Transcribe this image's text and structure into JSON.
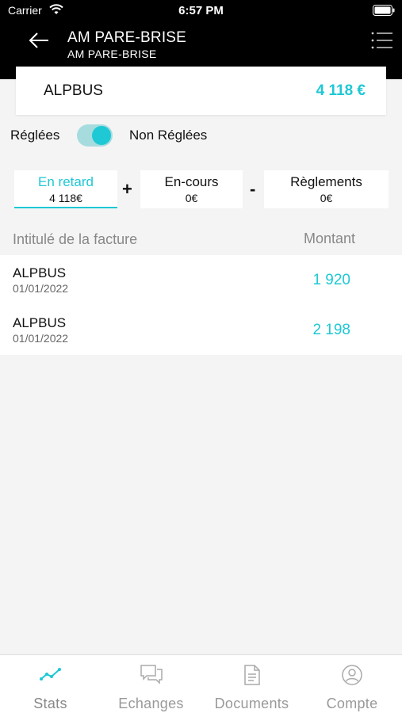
{
  "status_bar": {
    "carrier": "Carrier",
    "time": "6:57 PM"
  },
  "header": {
    "title": "AM PARE-BRISE",
    "subtitle": "AM PARE-BRISE",
    "back_icon": "arrow-left-icon",
    "menu_icon": "list-menu-icon"
  },
  "summary": {
    "name": "ALPBUS",
    "amount": "4 118 €"
  },
  "toggle": {
    "left_label": "Réglées",
    "right_label": "Non Réglées",
    "state": "on"
  },
  "tabs": [
    {
      "label": "En retard",
      "value": "4 118€",
      "active": true
    },
    {
      "label": "En-cours",
      "value": "0€",
      "active": false
    },
    {
      "label": "Règlements",
      "value": "0€",
      "active": false
    }
  ],
  "operators": {
    "plus": "+",
    "minus": "-"
  },
  "columns": {
    "title": "Intitulé de la facture",
    "amount": "Montant"
  },
  "invoices": [
    {
      "name": "ALPBUS",
      "date": "01/01/2022",
      "amount": "1 920"
    },
    {
      "name": "ALPBUS",
      "date": "01/01/2022",
      "amount": "2 198"
    }
  ],
  "nav": [
    {
      "label": "Stats",
      "icon": "chart-line-icon",
      "active": true
    },
    {
      "label": "Echanges",
      "icon": "chat-bubbles-icon",
      "active": false
    },
    {
      "label": "Documents",
      "icon": "document-icon",
      "active": false
    },
    {
      "label": "Compte",
      "icon": "user-circle-icon",
      "active": false
    }
  ],
  "colors": {
    "accent": "#1ec8d4",
    "header_bg": "#000000",
    "toggle_track": "#a7dcdf"
  }
}
